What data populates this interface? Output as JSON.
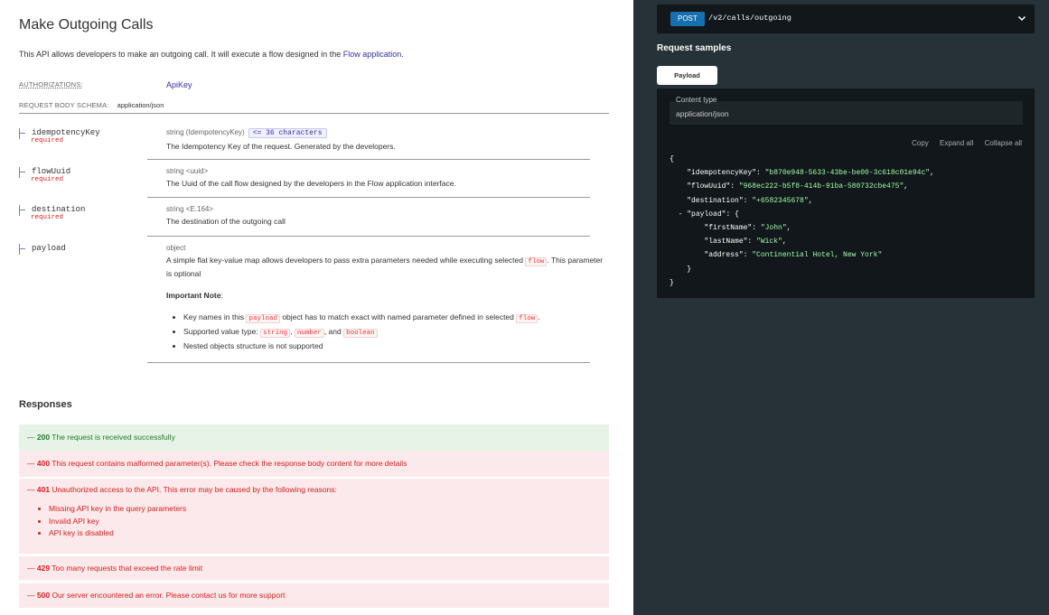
{
  "operation": {
    "title": "Make Outgoing Calls",
    "description_prefix": "This API allows developers to make an outgoing call. It will execute a flow designed in the ",
    "description_link": "Flow application",
    "description_suffix": ".",
    "authorizations_label": "AUTHORIZATIONS:",
    "authorizations_value": "ApiKey",
    "schema_label": "REQUEST BODY SCHEMA:",
    "schema_value": "application/json"
  },
  "properties": [
    {
      "name": "idempotencyKey",
      "required": "required",
      "type": "string (IdempotencyKey)",
      "constraint": "<= 36 characters",
      "description": "The Idempotency Key of the request. Generated by the developers."
    },
    {
      "name": "flowUuid",
      "required": "required",
      "type": "string <uuid>",
      "description": "The Uuid of the call flow designed by the developers in the Flow application interface."
    },
    {
      "name": "destination",
      "required": "required",
      "type": "string <E.164>",
      "description": "The destination of the outgoing call"
    },
    {
      "name": "payload",
      "type": "object",
      "description_prefix": "A simple flat key-value map allows developers to pass extra parameters needed while executing selected ",
      "description_code": "flow",
      "description_suffix": ". This parameter is optional",
      "note_label": "Important Note",
      "note_colon": ":",
      "note_items": [
        {
          "prefix": "Key names in this ",
          "code1": "payload",
          "middle": " object has to match exact with named parameter defined in selected ",
          "code2": "flow",
          "suffix": "."
        },
        {
          "prefix": "Supported value type: ",
          "code1": "string",
          "sep1": ", ",
          "code2": "number",
          "sep2": ", and ",
          "code3": "boolean"
        },
        {
          "text": "Nested objects structure is not supported"
        }
      ]
    }
  ],
  "responses": {
    "title": "Responses",
    "items": [
      {
        "code": "200",
        "prefix": "— ",
        "text": "The request is received successfully"
      },
      {
        "code": "400",
        "prefix": "— ",
        "text": "This request contains malformed parameter(s). Please check the response body content for more details"
      },
      {
        "code": "401",
        "prefix": "— ",
        "text": "Unauthorized access to the API. This error may be caused by the following reasons:",
        "reasons": [
          "Missing API key in the query parameters",
          "Invalid API key",
          "API key is disabled"
        ]
      },
      {
        "code": "429",
        "prefix": "— ",
        "text": "Too many requests that exceed the rate limit"
      },
      {
        "code": "500",
        "prefix": "— ",
        "text": "Our server encountered an error. Please contact us for more support"
      }
    ]
  },
  "right_panel": {
    "method": "POST",
    "path": "/v2/calls/outgoing",
    "samples_title": "Request samples",
    "tab_label": "Payload",
    "content_type_label": "Content type",
    "content_type_value": "application/json",
    "actions": {
      "copy": "Copy",
      "expand": "Expand all",
      "collapse": "Collapse all"
    },
    "json_sample": {
      "idempotencyKey": "\"b870e948-5633-43be-be00-3c618c01e94c\"",
      "flowUuid": "\"968ec222-b5f8-414b-91ba-580732cbe475\"",
      "destination": "\"+6582345678\"",
      "firstName": "\"John\"",
      "lastName": "\"Wick\"",
      "address": "\"Continential Hotel, New York\""
    }
  },
  "colors": {
    "link": "#32329f",
    "required": "#d41f1c",
    "success": "#1d8127",
    "error": "#d41f1c",
    "panel_bg": "#263238",
    "post_badge": "#186fb0",
    "json_string": "#a0fbaa"
  }
}
